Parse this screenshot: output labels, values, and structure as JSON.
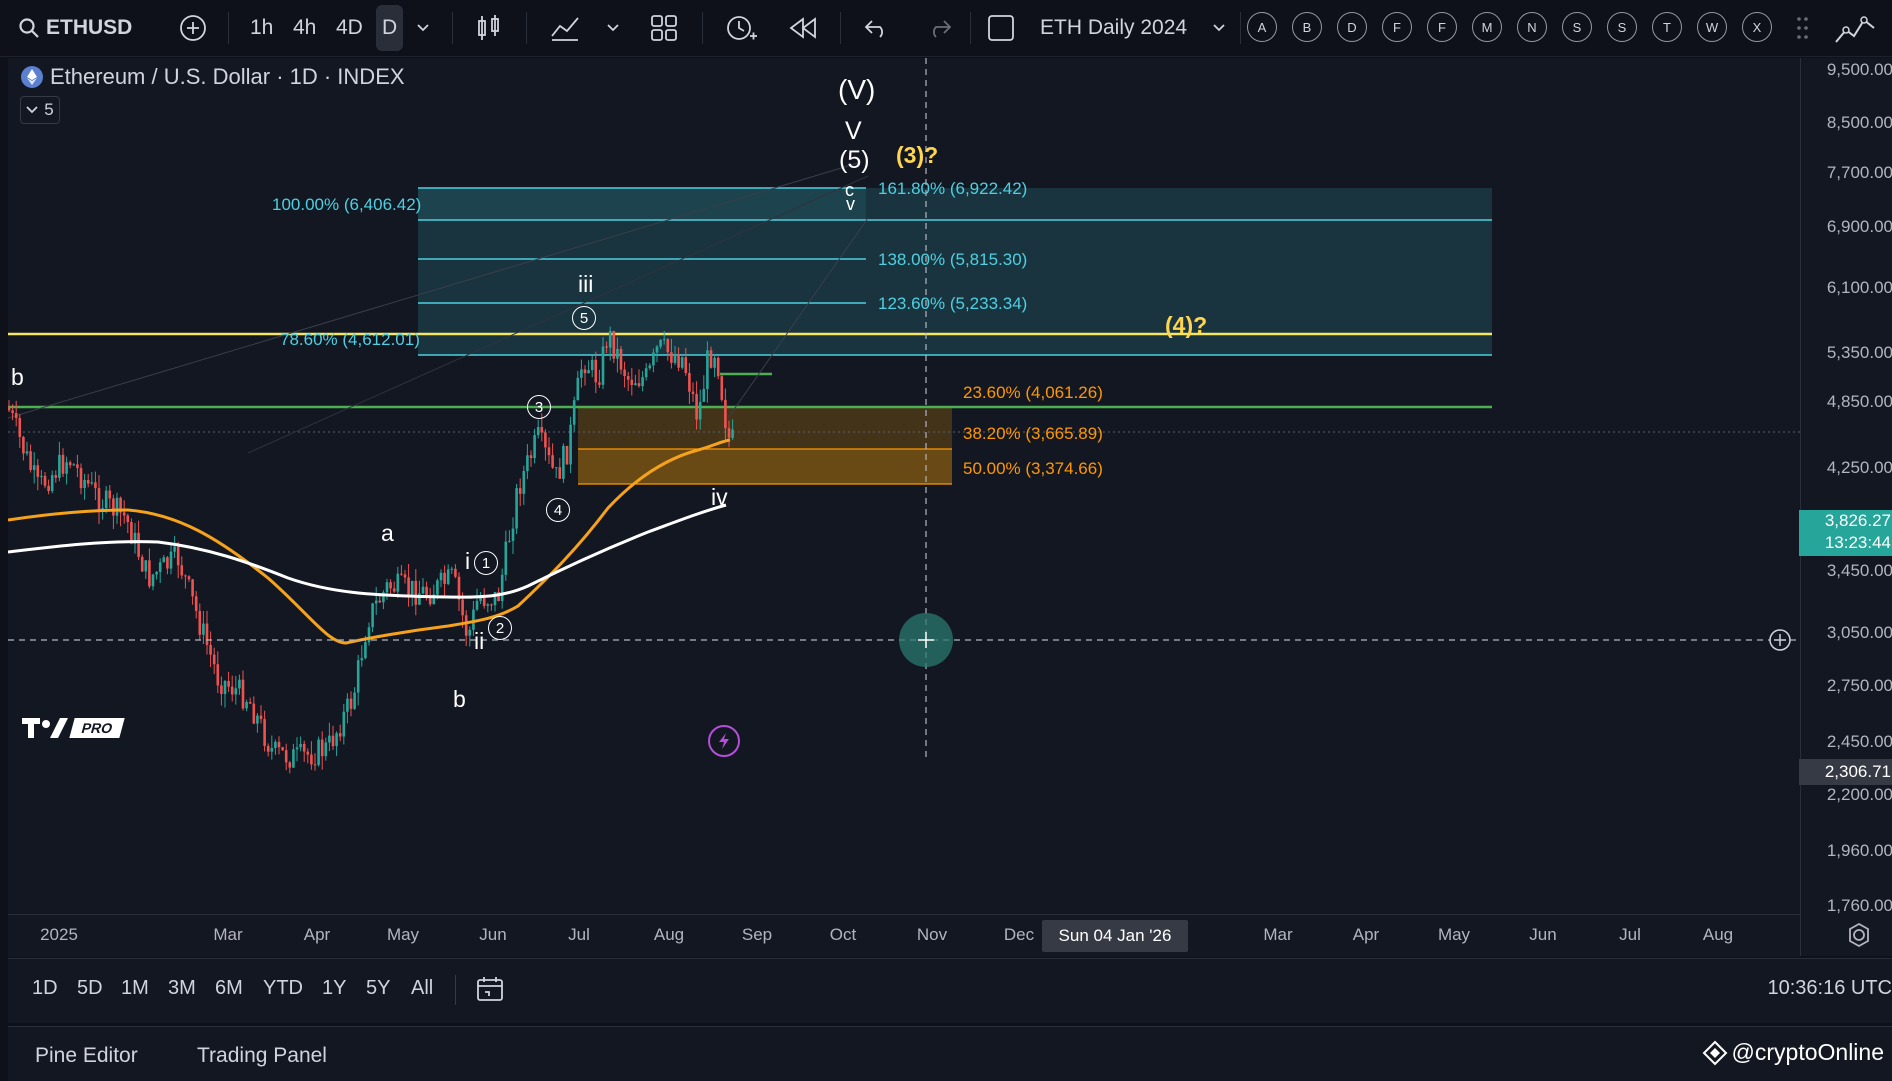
{
  "toolbar": {
    "symbol": "ETHUSD",
    "timeframes": [
      "1h",
      "4h",
      "4D",
      "D"
    ],
    "layout_name": "ETH Daily 2024",
    "letter_buttons": [
      "A",
      "B",
      "D",
      "F",
      "F",
      "M",
      "N",
      "S",
      "S",
      "T",
      "W",
      "X"
    ]
  },
  "chart": {
    "legend_title": "Ethereum / U.S. Dollar · 1D · INDEX",
    "indicator_collapse": "5",
    "watermark": "PRO",
    "crosshair_date": "Sun 04 Jan '26",
    "last_price": "3,826.27",
    "countdown": "13:23:44",
    "crosshair_price": "2,306.71"
  },
  "price_axis": [
    "9,500.00",
    "8,500.00",
    "7,700.00",
    "6,900.00",
    "6,100.00",
    "5,350.00",
    "4,850.00",
    "4,250.00",
    "3,450.00",
    "3,050.00",
    "2,750.00",
    "2,450.00",
    "2,200.00",
    "1,960.00",
    "1,760.00"
  ],
  "time_axis": [
    "2025",
    "Mar",
    "Apr",
    "May",
    "Jun",
    "Jul",
    "Aug",
    "Sep",
    "Oct",
    "Nov",
    "Dec",
    "Mar",
    "Apr",
    "May",
    "Jun",
    "Jul",
    "Aug"
  ],
  "fib_ext": {
    "level_100": "100.00% (6,406.42)",
    "level_786": "78.60% (4,612.01)",
    "level_1618": "161.80% (6,922.42)",
    "level_138": "138.00% (5,815.30)",
    "level_1236": "123.60% (5,233.34)"
  },
  "fib_ret": {
    "level_236": "23.60% (4,061.26)",
    "level_382": "38.20% (3,665.89)",
    "level_50": "50.00% (3,374.66)"
  },
  "waves": {
    "big_V": "(V)",
    "V": "V",
    "five_paren": "(5)",
    "three_q": "(3)?",
    "four_q": "(4)?",
    "c": "c",
    "v": "v",
    "iii": "iii",
    "iv": "iv",
    "i": "i",
    "ii": "ii",
    "a": "a",
    "b_left": "b",
    "b_low": "b",
    "c1": "1",
    "c2": "2",
    "c3": "3",
    "c4": "4",
    "c5": "5"
  },
  "bottom": {
    "ranges": [
      "1D",
      "5D",
      "1M",
      "3M",
      "6M",
      "YTD",
      "1Y",
      "5Y",
      "All"
    ],
    "clock": "10:36:16 UTC"
  },
  "panels": {
    "pine_editor": "Pine Editor",
    "trading_panel": "Trading Panel",
    "credit": "@cryptoOnline"
  },
  "colors": {
    "background": "#131722",
    "yellow_line": "#f5e663",
    "green_line": "#4caf50",
    "ma_orange": "#f7a21b",
    "ma_white": "#ffffff",
    "fib_cyan": "#4dd0e1",
    "fib_orange": "#ff9800",
    "price_badge": "#26a69a"
  }
}
